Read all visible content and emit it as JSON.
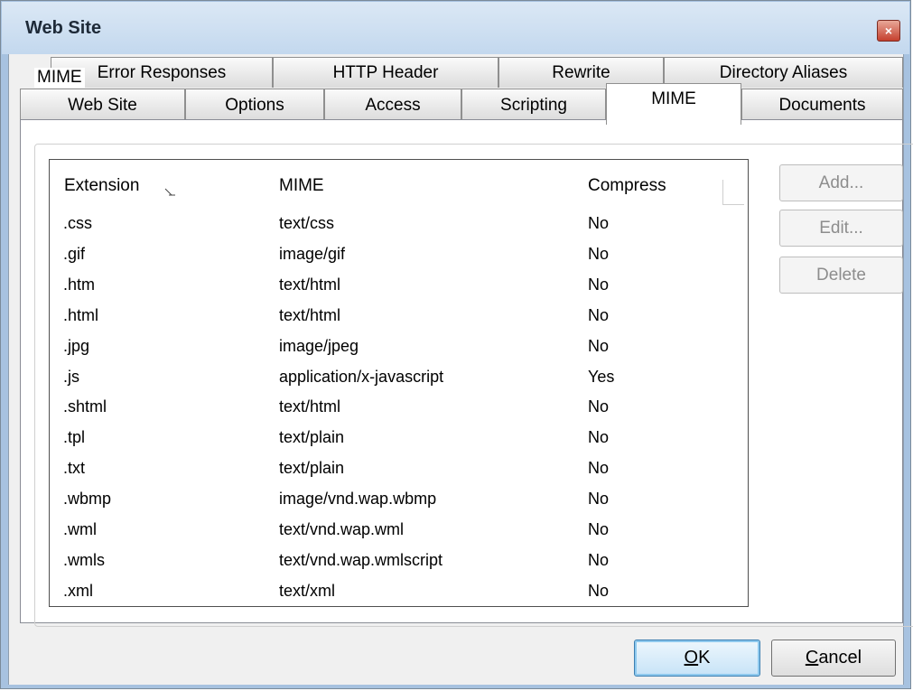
{
  "window": {
    "title": "Web Site",
    "close_glyph": "×"
  },
  "tabs_row1": [
    {
      "label": "Error Responses"
    },
    {
      "label": "HTTP Header"
    },
    {
      "label": "Rewrite"
    },
    {
      "label": "Directory Aliases"
    }
  ],
  "tabs_row2": [
    {
      "label": "Web Site"
    },
    {
      "label": "Options"
    },
    {
      "label": "Access"
    },
    {
      "label": "Scripting"
    },
    {
      "label": "MIME",
      "active": true
    },
    {
      "label": "Documents"
    }
  ],
  "group": {
    "label": "MIME"
  },
  "list": {
    "columns": [
      {
        "label": "Extension",
        "sorted": true
      },
      {
        "label": "MIME"
      },
      {
        "label": "Compress"
      }
    ],
    "rows": [
      {
        "ext": ".css",
        "mime": "text/css",
        "compress": "No"
      },
      {
        "ext": ".gif",
        "mime": "image/gif",
        "compress": "No"
      },
      {
        "ext": ".htm",
        "mime": "text/html",
        "compress": "No"
      },
      {
        "ext": ".html",
        "mime": "text/html",
        "compress": "No"
      },
      {
        "ext": ".jpg",
        "mime": "image/jpeg",
        "compress": "No"
      },
      {
        "ext": ".js",
        "mime": "application/x-javascript",
        "compress": "Yes"
      },
      {
        "ext": ".shtml",
        "mime": "text/html",
        "compress": "No"
      },
      {
        "ext": ".tpl",
        "mime": "text/plain",
        "compress": "No"
      },
      {
        "ext": ".txt",
        "mime": "text/plain",
        "compress": "No"
      },
      {
        "ext": ".wbmp",
        "mime": "image/vnd.wap.wbmp",
        "compress": "No"
      },
      {
        "ext": ".wml",
        "mime": "text/vnd.wap.wml",
        "compress": "No"
      },
      {
        "ext": ".wmls",
        "mime": "text/vnd.wap.wmlscript",
        "compress": "No"
      },
      {
        "ext": ".xml",
        "mime": "text/xml",
        "compress": "No"
      }
    ]
  },
  "side_buttons": [
    {
      "label": "Add...",
      "name": "add-button",
      "enabled": false
    },
    {
      "label": "Edit...",
      "name": "edit-button",
      "enabled": false
    },
    {
      "label": "Delete",
      "name": "delete-button",
      "enabled": false
    }
  ],
  "dialog_buttons": {
    "ok_label": "OK",
    "cancel_label": "Cancel"
  },
  "colors": {
    "frame": "#a7c2e0",
    "default_button_border": "#3c7fb1",
    "close_button": "#c5402e"
  }
}
